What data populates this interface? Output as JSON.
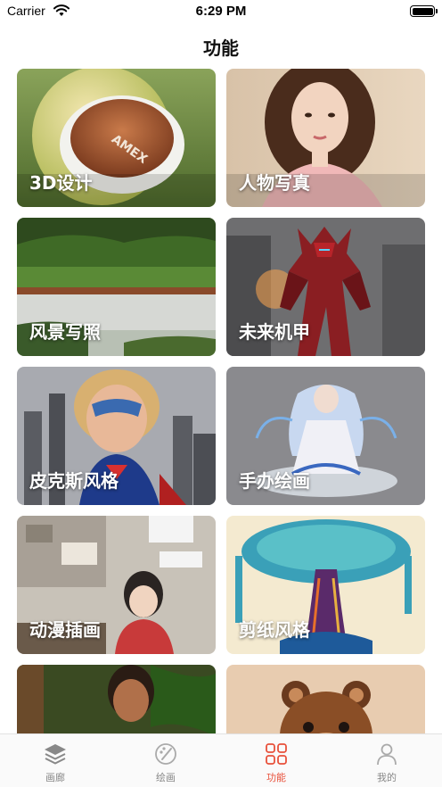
{
  "status": {
    "carrier": "Carrier",
    "time": "6:29 PM"
  },
  "title": "功能",
  "cards": [
    {
      "label": "3D设计",
      "icon": "ball-image"
    },
    {
      "label": "人物写真",
      "icon": "portrait-image"
    },
    {
      "label": "风景写照",
      "icon": "landscape-image"
    },
    {
      "label": "未来机甲",
      "icon": "mecha-image"
    },
    {
      "label": "皮克斯风格",
      "icon": "pixar-image"
    },
    {
      "label": "手办绘画",
      "icon": "figure-image"
    },
    {
      "label": "动漫插画",
      "icon": "anime-image"
    },
    {
      "label": "剪纸风格",
      "icon": "papercut-image"
    },
    {
      "label": "",
      "icon": "jungle-image"
    },
    {
      "label": "",
      "icon": "bear-image"
    }
  ],
  "tabs": [
    {
      "label": "画廊",
      "icon": "layers-icon",
      "active": false
    },
    {
      "label": "绘画",
      "icon": "palette-icon",
      "active": false
    },
    {
      "label": "功能",
      "icon": "grid-icon",
      "active": true
    },
    {
      "label": "我的",
      "icon": "person-icon",
      "active": false
    }
  ],
  "colors": {
    "accent": "#e8503a",
    "tab_inactive": "#888888"
  }
}
